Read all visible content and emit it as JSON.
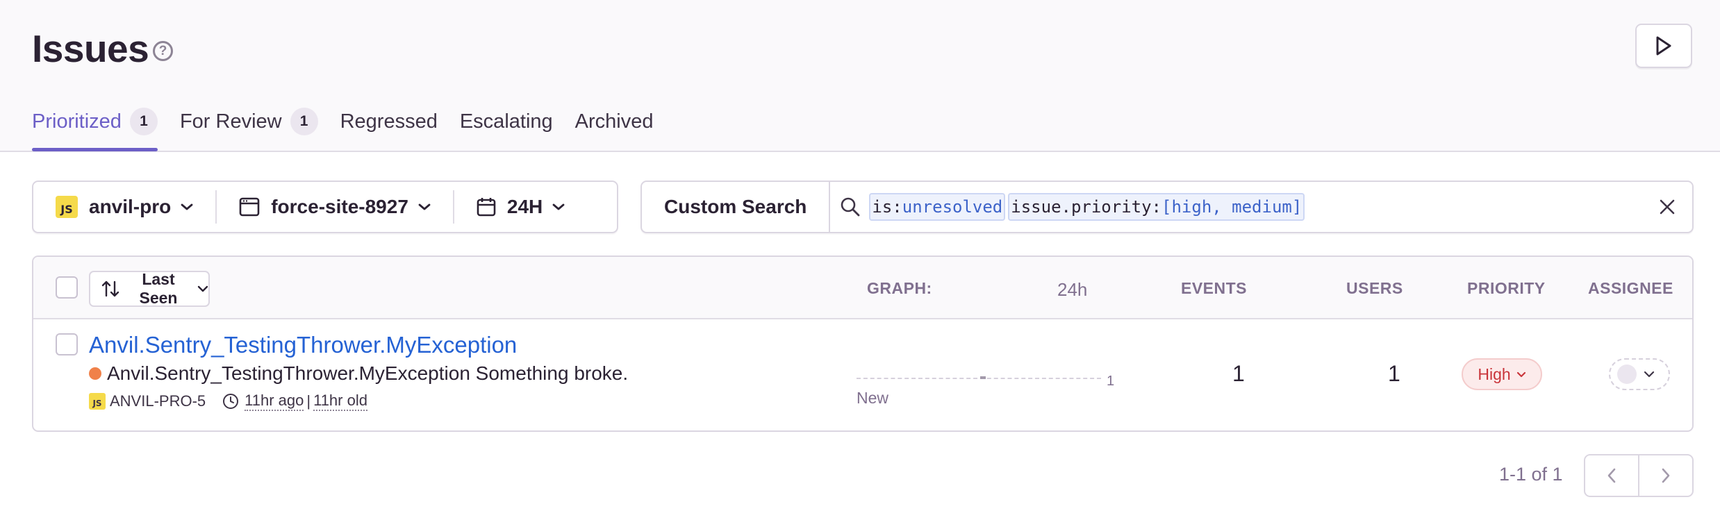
{
  "header": {
    "title": "Issues",
    "help_icon": "question-circle-icon",
    "play_icon": "play-icon"
  },
  "tabs": [
    {
      "label": "Prioritized",
      "count": "1",
      "active": true
    },
    {
      "label": "For Review",
      "count": "1",
      "active": false
    },
    {
      "label": "Regressed",
      "active": false
    },
    {
      "label": "Escalating",
      "active": false
    },
    {
      "label": "Archived",
      "active": false
    }
  ],
  "filters": {
    "project": {
      "badge": "JS",
      "label": "anvil-pro"
    },
    "environment": {
      "label": "force-site-8927",
      "icon": "window-icon"
    },
    "date": {
      "label": "24H",
      "icon": "calendar-icon"
    }
  },
  "search": {
    "custom_label": "Custom Search",
    "tokens": [
      {
        "key": "is:",
        "value": "unresolved"
      },
      {
        "key": "issue.priority:",
        "value": "[high, medium]"
      }
    ]
  },
  "table": {
    "sort_label": "Last Seen",
    "columns": {
      "graph": "GRAPH:",
      "graph_period": "24h",
      "events": "EVENTS",
      "users": "USERS",
      "priority": "PRIORITY",
      "assignee": "ASSIGNEE"
    },
    "rows": [
      {
        "title": "Anvil.Sentry_TestingThrower.MyException",
        "message": "Anvil.Sentry_TestingThrower.MyException Something broke.",
        "level_color": "#f0814a",
        "platform_badge": "JS",
        "short_id": "ANVIL-PRO-5",
        "last_seen": "11hr ago",
        "age": "11hr old",
        "graph_max": "1",
        "graph_label": "New",
        "events": "1",
        "users": "1",
        "priority": "High"
      }
    ]
  },
  "pagination": {
    "summary": "1-1 of 1"
  },
  "colors": {
    "accent": "#6c5fc7",
    "link": "#2562d4",
    "priority_high": "#c9343a"
  }
}
